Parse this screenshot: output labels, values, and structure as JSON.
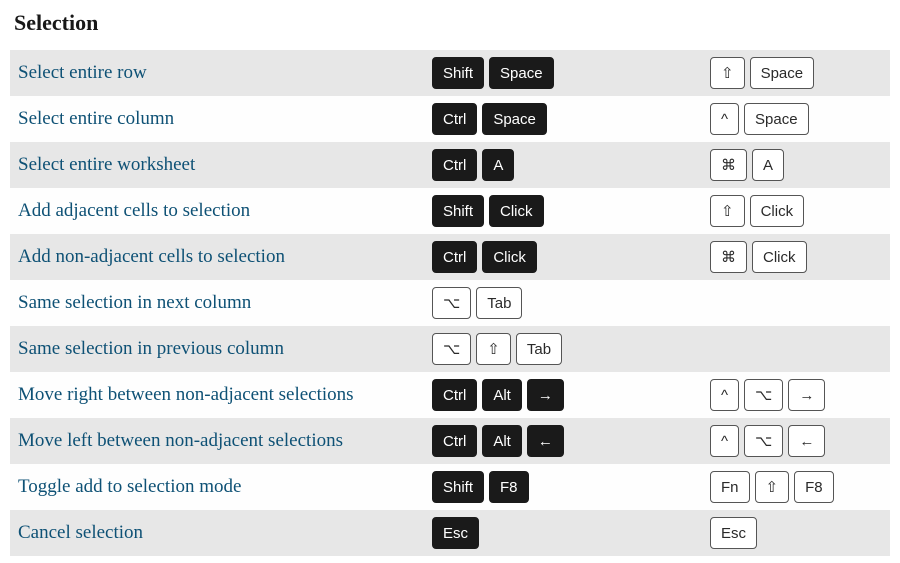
{
  "section_title": "Selection",
  "rows": [
    {
      "desc": "Select entire row",
      "win": [
        "Shift",
        "Space"
      ],
      "win_style": [
        "dark",
        "dark"
      ],
      "mac": [
        "⇧",
        "Space"
      ],
      "mac_style": [
        "light",
        "light"
      ]
    },
    {
      "desc": "Select entire column",
      "win": [
        "Ctrl",
        "Space"
      ],
      "win_style": [
        "dark",
        "dark"
      ],
      "mac": [
        "^",
        "Space"
      ],
      "mac_style": [
        "light",
        "light"
      ]
    },
    {
      "desc": "Select entire worksheet",
      "win": [
        "Ctrl",
        "A"
      ],
      "win_style": [
        "dark",
        "dark"
      ],
      "mac": [
        "⌘",
        "A"
      ],
      "mac_style": [
        "light",
        "light"
      ]
    },
    {
      "desc": "Add adjacent cells to selection",
      "win": [
        "Shift",
        "Click"
      ],
      "win_style": [
        "dark",
        "dark"
      ],
      "mac": [
        "⇧",
        "Click"
      ],
      "mac_style": [
        "light",
        "light"
      ]
    },
    {
      "desc": "Add non-adjacent cells to selection",
      "win": [
        "Ctrl",
        "Click"
      ],
      "win_style": [
        "dark",
        "dark"
      ],
      "mac": [
        "⌘",
        "Click"
      ],
      "mac_style": [
        "light",
        "light"
      ]
    },
    {
      "desc": "Same selection in next column",
      "win": [
        "⌥",
        "Tab"
      ],
      "win_style": [
        "light",
        "light"
      ],
      "mac": [],
      "mac_style": []
    },
    {
      "desc": "Same selection in previous column",
      "win": [
        "⌥",
        "⇧",
        "Tab"
      ],
      "win_style": [
        "light",
        "light",
        "light"
      ],
      "mac": [],
      "mac_style": []
    },
    {
      "desc": "Move right between non-adjacent selections",
      "win": [
        "Ctrl",
        "Alt",
        "→"
      ],
      "win_style": [
        "dark",
        "dark",
        "dark"
      ],
      "mac": [
        "^",
        "⌥",
        "→"
      ],
      "mac_style": [
        "light",
        "light",
        "light"
      ]
    },
    {
      "desc": "Move left between non-adjacent selections",
      "win": [
        "Ctrl",
        "Alt",
        "←"
      ],
      "win_style": [
        "dark",
        "dark",
        "dark"
      ],
      "mac": [
        "^",
        "⌥",
        "←"
      ],
      "mac_style": [
        "light",
        "light",
        "light"
      ]
    },
    {
      "desc": "Toggle add to selection mode",
      "win": [
        "Shift",
        "F8"
      ],
      "win_style": [
        "dark",
        "dark"
      ],
      "mac": [
        "Fn",
        "⇧",
        "F8"
      ],
      "mac_style": [
        "light",
        "light",
        "light"
      ]
    },
    {
      "desc": "Cancel selection",
      "win": [
        "Esc"
      ],
      "win_style": [
        "dark"
      ],
      "mac": [
        "Esc"
      ],
      "mac_style": [
        "light"
      ]
    }
  ]
}
